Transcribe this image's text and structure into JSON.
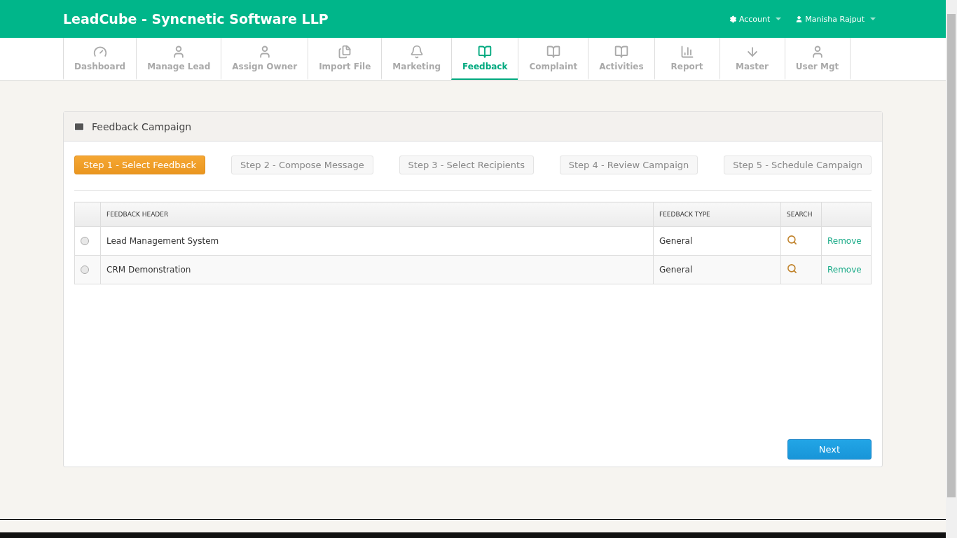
{
  "header": {
    "title": "LeadCube - Syncnetic Software LLP",
    "menus": [
      {
        "label": "Account",
        "kind": "gear"
      },
      {
        "label": "Manisha Rajput",
        "kind": "user"
      }
    ]
  },
  "nav": [
    {
      "label": "Dashboard",
      "kind": "gauge",
      "selected": false
    },
    {
      "label": "Manage Lead",
      "kind": "user",
      "selected": false
    },
    {
      "label": "Assign Owner",
      "kind": "user",
      "selected": false
    },
    {
      "label": "Import File",
      "kind": "files",
      "selected": false
    },
    {
      "label": "Marketing",
      "kind": "bell",
      "selected": false
    },
    {
      "label": "Feedback",
      "kind": "book",
      "selected": true
    },
    {
      "label": "Complaint",
      "kind": "book",
      "selected": false
    },
    {
      "label": "Activities",
      "kind": "book",
      "selected": false
    },
    {
      "label": "Report",
      "kind": "chart",
      "selected": false
    },
    {
      "label": "Master",
      "kind": "arrow",
      "selected": false
    },
    {
      "label": "User Mgt",
      "kind": "user",
      "selected": false
    }
  ],
  "panel": {
    "title": "Feedback Campaign",
    "steps": [
      {
        "label": "Step 1 - Select Feedback",
        "selected": true
      },
      {
        "label": "Step 2 - Compose Message",
        "selected": false
      },
      {
        "label": "Step 3 - Select Recipients",
        "selected": false
      },
      {
        "label": "Step 4 - Review Campaign",
        "selected": false
      },
      {
        "label": "Step 5 - Schedule Campaign",
        "selected": false
      }
    ],
    "table": {
      "columns": [
        "FEEDBACK HEADER",
        "FEEDBACK TYPE",
        "SEARCH"
      ],
      "rows": [
        {
          "selected": false,
          "header": "Lead Management System",
          "type": "General",
          "action": "Remove"
        },
        {
          "selected": false,
          "header": "CRM Demonstration",
          "type": "General",
          "action": "Remove"
        }
      ]
    },
    "next_button": "Next"
  }
}
